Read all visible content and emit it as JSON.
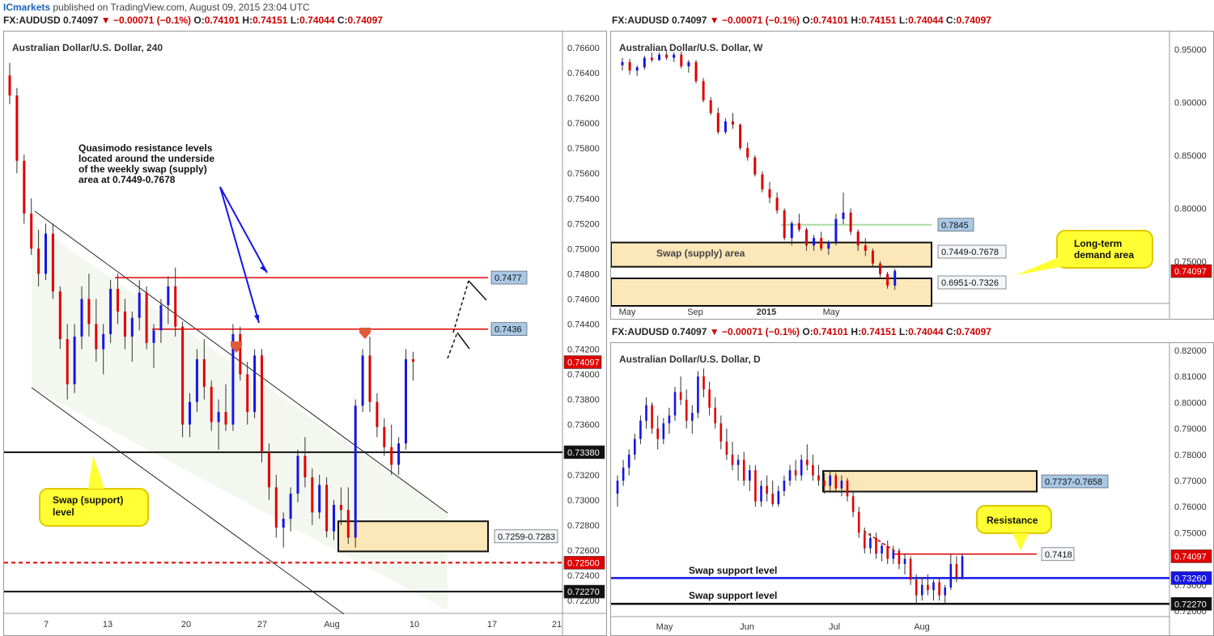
{
  "header": {
    "brand": "ICmarkets",
    "published": "published on TradingView.com, August 09, 2015 23:04 UTC"
  },
  "quote": {
    "symbol": "FX:AUDUSD",
    "last": "0.74097",
    "change": "▼ −0.00071 (−0.1%)",
    "o": "0.74101",
    "h": "0.74151",
    "l": "0.74044",
    "c": "0.74097"
  },
  "colors": {
    "bull": "#1515e8",
    "bear": "#e00000",
    "zone_fill": "#fbe7b8",
    "callout": "#ffff33",
    "price_tag": "#e00000"
  },
  "panels": {
    "h4": {
      "title": "Australian Dollar/U.S. Dollar, 240",
      "x_ticks": [
        "7",
        "13",
        "20",
        "27",
        "Aug",
        "10",
        "17",
        "21"
      ],
      "y_ticks": [
        "0.76600",
        "0.76400",
        "0.76200",
        "0.76000",
        "0.75800",
        "0.75600",
        "0.75400",
        "0.75200",
        "0.75000",
        "0.74800",
        "0.74600",
        "0.74400",
        "0.74200",
        "0.74000",
        "0.73800",
        "0.73600",
        "0.73400",
        "0.73200",
        "0.73000",
        "0.72800",
        "0.72600",
        "0.72400",
        "0.72200"
      ],
      "tags": {
        "last": "0.74097",
        "r1": "0.7477",
        "r2": "0.7436",
        "swap": "0.73380",
        "red_dash": "0.72500",
        "support": "0.72270",
        "zone": "0.7259-0.7283"
      },
      "note_top": "Quasimodo resistance levels located around the underside of the weekly swap (supply) area at 0.7449-0.7678",
      "callout": "Swap (support) level"
    },
    "weekly": {
      "title": "Australian Dollar/U.S. Dollar, W",
      "x_ticks": [
        "May",
        "Sep",
        "2015",
        "May"
      ],
      "y_ticks": [
        "0.95000",
        "0.90000",
        "0.85000",
        "0.80000",
        "0.75000"
      ],
      "tags": {
        "last": "0.74097",
        "green": "0.7845",
        "supply": "0.7449-0.7678",
        "demand": "0.6951-0.7326"
      },
      "zone_label": "Swap (supply) area",
      "callout": "Long-term demand area"
    },
    "daily": {
      "title": "Australian Dollar/U.S. Dollar, D",
      "x_ticks": [
        "May",
        "Jun",
        "Jul",
        "Aug"
      ],
      "y_ticks": [
        "0.82000",
        "0.81000",
        "0.80000",
        "0.79000",
        "0.78000",
        "0.77000",
        "0.76000",
        "0.75000",
        "0.74000",
        "0.73000",
        "0.72000"
      ],
      "tags": {
        "last": "0.74097",
        "blue": "0.73260",
        "black": "0.72270",
        "resistance": "0.7418",
        "zone": "0.7737-0.7658"
      },
      "label_swap1": "Swap support level",
      "label_swap2": "Swap support level",
      "callout": "Resistance"
    }
  },
  "chart_data": [
    {
      "type": "candlestick",
      "title": "Australian Dollar/U.S. Dollar, 240",
      "ylim": [
        0.721,
        0.768
      ],
      "levels": [
        0.7477,
        0.7436,
        0.7338,
        0.725,
        0.7227
      ],
      "zones": [
        [
          0.7259,
          0.7283
        ]
      ],
      "ohlc": [
        [
          0.7638,
          0.7648,
          0.7615,
          0.7622
        ],
        [
          0.7622,
          0.7628,
          0.756,
          0.757
        ],
        [
          0.757,
          0.7575,
          0.752,
          0.7528
        ],
        [
          0.7528,
          0.754,
          0.7495,
          0.75
        ],
        [
          0.75,
          0.7515,
          0.747,
          0.748
        ],
        [
          0.748,
          0.752,
          0.7475,
          0.7512
        ],
        [
          0.7512,
          0.752,
          0.746,
          0.7466
        ],
        [
          0.7466,
          0.747,
          0.742,
          0.7428
        ],
        [
          0.7428,
          0.744,
          0.738,
          0.7392
        ],
        [
          0.7392,
          0.744,
          0.7385,
          0.743
        ],
        [
          0.743,
          0.747,
          0.742,
          0.746
        ],
        [
          0.746,
          0.748,
          0.743,
          0.744
        ],
        [
          0.744,
          0.746,
          0.741,
          0.742
        ],
        [
          0.742,
          0.744,
          0.74,
          0.7432
        ],
        [
          0.7432,
          0.7475,
          0.7425,
          0.7468
        ],
        [
          0.7468,
          0.748,
          0.744,
          0.745
        ],
        [
          0.745,
          0.746,
          0.742,
          0.743
        ],
        [
          0.743,
          0.745,
          0.741,
          0.7445
        ],
        [
          0.7445,
          0.7475,
          0.7435,
          0.7465
        ],
        [
          0.7465,
          0.747,
          0.742,
          0.7425
        ],
        [
          0.7425,
          0.744,
          0.7405,
          0.7435
        ],
        [
          0.7435,
          0.746,
          0.7425,
          0.7455
        ],
        [
          0.7455,
          0.7478,
          0.744,
          0.747
        ],
        [
          0.747,
          0.7485,
          0.743,
          0.7438
        ],
        [
          0.7438,
          0.7442,
          0.735,
          0.736
        ],
        [
          0.736,
          0.7385,
          0.735,
          0.7378
        ],
        [
          0.7378,
          0.742,
          0.737,
          0.7412
        ],
        [
          0.7412,
          0.7428,
          0.738,
          0.739
        ],
        [
          0.739,
          0.7395,
          0.7355,
          0.7362
        ],
        [
          0.7362,
          0.738,
          0.734,
          0.737
        ],
        [
          0.737,
          0.7392,
          0.7355,
          0.736
        ],
        [
          0.736,
          0.744,
          0.7355,
          0.7432
        ],
        [
          0.7432,
          0.7438,
          0.7395,
          0.74
        ],
        [
          0.74,
          0.741,
          0.736,
          0.737
        ],
        [
          0.737,
          0.742,
          0.7365,
          0.7415
        ],
        [
          0.7415,
          0.742,
          0.733,
          0.7338
        ],
        [
          0.7338,
          0.7345,
          0.73,
          0.731
        ],
        [
          0.731,
          0.732,
          0.727,
          0.7278
        ],
        [
          0.7278,
          0.729,
          0.7262,
          0.7285
        ],
        [
          0.7285,
          0.731,
          0.7275,
          0.7305
        ],
        [
          0.7305,
          0.734,
          0.7298,
          0.7335
        ],
        [
          0.7335,
          0.735,
          0.731,
          0.7318
        ],
        [
          0.7318,
          0.7325,
          0.728,
          0.729
        ],
        [
          0.729,
          0.732,
          0.7285,
          0.7312
        ],
        [
          0.7312,
          0.7318,
          0.727,
          0.7275
        ],
        [
          0.7275,
          0.73,
          0.7268,
          0.7296
        ],
        [
          0.7296,
          0.731,
          0.728,
          0.7292
        ],
        [
          0.7292,
          0.731,
          0.7265,
          0.727
        ],
        [
          0.727,
          0.738,
          0.7262,
          0.7375
        ],
        [
          0.7375,
          0.742,
          0.737,
          0.7415
        ],
        [
          0.7415,
          0.743,
          0.737,
          0.7378
        ],
        [
          0.7378,
          0.7385,
          0.735,
          0.7358
        ],
        [
          0.7358,
          0.7365,
          0.7335,
          0.7342
        ],
        [
          0.7342,
          0.736,
          0.732,
          0.7328
        ],
        [
          0.7328,
          0.735,
          0.732,
          0.7345
        ],
        [
          0.7345,
          0.742,
          0.734,
          0.7412
        ],
        [
          0.7412,
          0.7418,
          0.7395,
          0.741
        ]
      ]
    },
    {
      "type": "candlestick",
      "title": "Australian Dollar/U.S. Dollar, W",
      "ylim": [
        0.71,
        0.965
      ],
      "levels": [
        0.7845
      ],
      "zones": [
        [
          0.7449,
          0.7678
        ],
        [
          0.6951,
          0.7326
        ]
      ],
      "ohlc": [
        [
          0.935,
          0.942,
          0.93,
          0.938
        ],
        [
          0.938,
          0.941,
          0.926,
          0.93
        ],
        [
          0.93,
          0.935,
          0.925,
          0.933
        ],
        [
          0.933,
          0.944,
          0.931,
          0.942
        ],
        [
          0.942,
          0.947,
          0.938,
          0.94
        ],
        [
          0.94,
          0.947,
          0.939,
          0.945
        ],
        [
          0.945,
          0.95,
          0.94,
          0.942
        ],
        [
          0.942,
          0.947,
          0.938,
          0.945
        ],
        [
          0.945,
          0.948,
          0.932,
          0.934
        ],
        [
          0.934,
          0.94,
          0.928,
          0.938
        ],
        [
          0.938,
          0.94,
          0.918,
          0.92
        ],
        [
          0.92,
          0.923,
          0.9,
          0.902
        ],
        [
          0.902,
          0.905,
          0.888,
          0.89
        ],
        [
          0.89,
          0.895,
          0.87,
          0.872
        ],
        [
          0.872,
          0.885,
          0.87,
          0.882
        ],
        [
          0.882,
          0.89,
          0.875,
          0.879
        ],
        [
          0.879,
          0.88,
          0.855,
          0.857
        ],
        [
          0.857,
          0.862,
          0.845,
          0.848
        ],
        [
          0.848,
          0.85,
          0.83,
          0.832
        ],
        [
          0.832,
          0.835,
          0.815,
          0.818
        ],
        [
          0.818,
          0.825,
          0.805,
          0.81
        ],
        [
          0.81,
          0.815,
          0.795,
          0.798
        ],
        [
          0.798,
          0.8,
          0.77,
          0.772
        ],
        [
          0.772,
          0.788,
          0.765,
          0.786
        ],
        [
          0.786,
          0.795,
          0.778,
          0.78
        ],
        [
          0.78,
          0.782,
          0.76,
          0.765
        ],
        [
          0.765,
          0.775,
          0.76,
          0.772
        ],
        [
          0.772,
          0.778,
          0.76,
          0.762
        ],
        [
          0.762,
          0.77,
          0.756,
          0.768
        ],
        [
          0.768,
          0.795,
          0.765,
          0.79
        ],
        [
          0.79,
          0.815,
          0.785,
          0.796
        ],
        [
          0.796,
          0.8,
          0.775,
          0.778
        ],
        [
          0.778,
          0.78,
          0.76,
          0.765
        ],
        [
          0.765,
          0.772,
          0.755,
          0.76
        ],
        [
          0.76,
          0.762,
          0.745,
          0.748
        ],
        [
          0.748,
          0.75,
          0.735,
          0.738
        ],
        [
          0.738,
          0.74,
          0.724,
          0.727
        ],
        [
          0.727,
          0.743,
          0.723,
          0.741
        ]
      ]
    },
    {
      "type": "candlestick",
      "title": "Australian Dollar/U.S. Dollar, D",
      "ylim": [
        0.716,
        0.82
      ],
      "levels": [
        0.7418,
        0.7326,
        0.7227
      ],
      "zones": [
        [
          0.7658,
          0.7737
        ]
      ],
      "ohlc": [
        [
          0.765,
          0.772,
          0.76,
          0.77
        ],
        [
          0.77,
          0.778,
          0.768,
          0.775
        ],
        [
          0.775,
          0.782,
          0.772,
          0.78
        ],
        [
          0.78,
          0.788,
          0.778,
          0.786
        ],
        [
          0.786,
          0.795,
          0.784,
          0.793
        ],
        [
          0.793,
          0.802,
          0.79,
          0.799
        ],
        [
          0.799,
          0.8,
          0.788,
          0.79
        ],
        [
          0.79,
          0.795,
          0.782,
          0.786
        ],
        [
          0.786,
          0.794,
          0.784,
          0.792
        ],
        [
          0.792,
          0.798,
          0.788,
          0.795
        ],
        [
          0.795,
          0.806,
          0.793,
          0.804
        ],
        [
          0.804,
          0.81,
          0.799,
          0.801
        ],
        [
          0.801,
          0.805,
          0.79,
          0.793
        ],
        [
          0.793,
          0.799,
          0.788,
          0.796
        ],
        [
          0.796,
          0.812,
          0.794,
          0.81
        ],
        [
          0.81,
          0.813,
          0.802,
          0.805
        ],
        [
          0.805,
          0.808,
          0.795,
          0.798
        ],
        [
          0.798,
          0.802,
          0.79,
          0.792
        ],
        [
          0.792,
          0.795,
          0.782,
          0.785
        ],
        [
          0.785,
          0.79,
          0.778,
          0.78
        ],
        [
          0.78,
          0.785,
          0.774,
          0.776
        ],
        [
          0.776,
          0.78,
          0.77,
          0.778
        ],
        [
          0.778,
          0.781,
          0.768,
          0.77
        ],
        [
          0.77,
          0.776,
          0.766,
          0.774
        ],
        [
          0.774,
          0.776,
          0.76,
          0.762
        ],
        [
          0.762,
          0.77,
          0.76,
          0.768
        ],
        [
          0.768,
          0.772,
          0.762,
          0.765
        ],
        [
          0.765,
          0.77,
          0.76,
          0.761
        ],
        [
          0.761,
          0.768,
          0.76,
          0.766
        ],
        [
          0.766,
          0.772,
          0.764,
          0.77
        ],
        [
          0.77,
          0.776,
          0.768,
          0.774
        ],
        [
          0.774,
          0.778,
          0.77,
          0.772
        ],
        [
          0.772,
          0.78,
          0.77,
          0.778
        ],
        [
          0.778,
          0.784,
          0.774,
          0.776
        ],
        [
          0.776,
          0.78,
          0.77,
          0.772
        ],
        [
          0.772,
          0.776,
          0.768,
          0.77
        ],
        [
          0.77,
          0.773,
          0.765,
          0.768
        ],
        [
          0.768,
          0.774,
          0.766,
          0.772
        ],
        [
          0.772,
          0.773,
          0.766,
          0.767
        ],
        [
          0.767,
          0.772,
          0.764,
          0.77
        ],
        [
          0.77,
          0.771,
          0.762,
          0.764
        ],
        [
          0.764,
          0.766,
          0.756,
          0.758
        ],
        [
          0.758,
          0.76,
          0.748,
          0.75
        ],
        [
          0.75,
          0.752,
          0.742,
          0.744
        ],
        [
          0.744,
          0.75,
          0.742,
          0.748
        ],
        [
          0.748,
          0.75,
          0.74,
          0.742
        ],
        [
          0.742,
          0.746,
          0.739,
          0.745
        ],
        [
          0.745,
          0.747,
          0.738,
          0.74
        ],
        [
          0.74,
          0.745,
          0.738,
          0.743
        ],
        [
          0.743,
          0.744,
          0.736,
          0.738
        ],
        [
          0.738,
          0.742,
          0.734,
          0.74
        ],
        [
          0.74,
          0.741,
          0.73,
          0.732
        ],
        [
          0.732,
          0.734,
          0.723,
          0.726
        ],
        [
          0.726,
          0.733,
          0.724,
          0.73
        ],
        [
          0.73,
          0.734,
          0.726,
          0.728
        ],
        [
          0.728,
          0.732,
          0.724,
          0.731
        ],
        [
          0.731,
          0.733,
          0.724,
          0.726
        ],
        [
          0.726,
          0.73,
          0.723,
          0.729
        ],
        [
          0.729,
          0.742,
          0.728,
          0.738
        ],
        [
          0.738,
          0.741,
          0.731,
          0.733
        ],
        [
          0.733,
          0.742,
          0.732,
          0.741
        ]
      ]
    }
  ]
}
